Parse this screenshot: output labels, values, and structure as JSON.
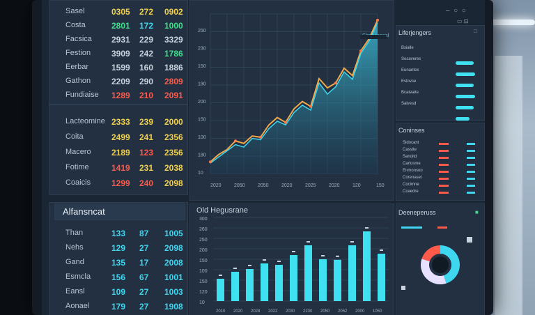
{
  "colors": {
    "yellow": "#f3d04a",
    "green": "#3ee08a",
    "cyan": "#3fd6f0",
    "red": "#ff5a4a",
    "text": "#c9d3df",
    "accent": "#3fd6f0"
  },
  "left_top_table": {
    "rows": [
      {
        "label": "Sasel",
        "a": "0305",
        "b": "272",
        "c": "0902",
        "colors": [
          "yellow",
          "yellow",
          "yellow"
        ]
      },
      {
        "label": "Costa",
        "a": "2801",
        "b": "172",
        "c": "1000",
        "colors": [
          "green",
          "cyan",
          "green"
        ]
      },
      {
        "label": "Facsica",
        "a": "2931",
        "b": "229",
        "c": "3329",
        "colors": [
          "text",
          "text",
          "text"
        ]
      },
      {
        "label": "Festion",
        "a": "3909",
        "b": "242",
        "c": "1786",
        "colors": [
          "text",
          "text",
          "green"
        ]
      },
      {
        "label": "Eerbar",
        "a": "1599",
        "b": "160",
        "c": "1886",
        "colors": [
          "text",
          "text",
          "text"
        ]
      },
      {
        "label": "Gathon",
        "a": "2209",
        "b": "290",
        "c": "2809",
        "colors": [
          "text",
          "text",
          "red"
        ]
      },
      {
        "label": "Fundiaise",
        "a": "1289",
        "b": "210",
        "c": "2091",
        "colors": [
          "red",
          "red",
          "red"
        ]
      }
    ]
  },
  "left_mid_table": {
    "rows": [
      {
        "label": "Lacteomine",
        "a": "2333",
        "b": "239",
        "c": "2000",
        "colors": [
          "yellow",
          "yellow",
          "yellow"
        ]
      },
      {
        "label": "Coita",
        "a": "2499",
        "b": "241",
        "c": "2356",
        "colors": [
          "yellow",
          "yellow",
          "yellow"
        ]
      },
      {
        "label": "Macero",
        "a": "2189",
        "b": "123",
        "c": "2356",
        "colors": [
          "yellow",
          "red",
          "yellow"
        ]
      },
      {
        "label": "Fotime",
        "a": "1419",
        "b": "231",
        "c": "2038",
        "colors": [
          "red",
          "yellow",
          "yellow"
        ]
      },
      {
        "label": "Coaicis",
        "a": "1299",
        "b": "240",
        "c": "2098",
        "colors": [
          "red",
          "red",
          "yellow"
        ]
      }
    ]
  },
  "left_bottom": {
    "title": "Alfansncat",
    "rows": [
      {
        "label": "Than",
        "a": "133",
        "b": "87",
        "c": "1005"
      },
      {
        "label": "Nehs",
        "a": "129",
        "b": "27",
        "c": "2098"
      },
      {
        "label": "Gand",
        "a": "135",
        "b": "17",
        "c": "2008"
      },
      {
        "label": "Esmcla",
        "a": "156",
        "b": "67",
        "c": "1001"
      },
      {
        "label": "Eansl",
        "a": "109",
        "b": "27",
        "c": "1003"
      },
      {
        "label": "Aonael",
        "a": "179",
        "b": "27",
        "c": "1908"
      }
    ]
  },
  "line_chart": {
    "header_text": "Slsdeconeal",
    "y_ticks": [
      "250",
      "230",
      "150",
      "180",
      "200",
      "150",
      "100",
      "180",
      "10"
    ],
    "x_ticks": [
      "2020",
      "2050",
      "2050",
      "2020",
      "2025",
      "2020",
      "120",
      "150"
    ]
  },
  "bar_chart": {
    "title": "Old Hegusrane",
    "y_ticks": [
      "300",
      "260",
      "250",
      "200",
      "150",
      "100",
      "150",
      "120",
      "10"
    ],
    "x_ticks": [
      "2010",
      "2020",
      "2028",
      "2022",
      "2030",
      "2230",
      "2050",
      "2052",
      "2000",
      "1050"
    ]
  },
  "chart_data": [
    {
      "type": "area",
      "title": "",
      "x": [
        1,
        2,
        3,
        4,
        5,
        6,
        7,
        8,
        9,
        10,
        11,
        12,
        13,
        14,
        15,
        16,
        17,
        18,
        19,
        20,
        21
      ],
      "series": [
        {
          "values": [
            20,
            32,
            40,
            54,
            50,
            62,
            60,
            80,
            92,
            84,
            106,
            118,
            110,
            155,
            140,
            148,
            172,
            160,
            200,
            220,
            250
          ]
        },
        {
          "values": [
            18,
            28,
            38,
            48,
            44,
            58,
            56,
            74,
            86,
            80,
            100,
            112,
            104,
            148,
            130,
            142,
            166,
            154,
            196,
            216,
            246
          ]
        }
      ],
      "ylim": [
        0,
        260
      ]
    },
    {
      "type": "bar",
      "title": "Old Hegusrane",
      "categories": [
        "1",
        "2",
        "3",
        "4",
        "5",
        "6",
        "7",
        "8",
        "9",
        "10",
        "11",
        "12"
      ],
      "values": [
        80,
        105,
        115,
        135,
        130,
        165,
        200,
        150,
        148,
        200,
        250,
        170
      ],
      "ylim": [
        0,
        300
      ]
    },
    {
      "type": "pie",
      "title": "Deeneperuss",
      "values": [
        45,
        35,
        20
      ],
      "colors": [
        "#3fd6f0",
        "#e8e0ff",
        "#ff5a4a"
      ]
    }
  ],
  "right_top": {
    "title": "Liferjengers",
    "rows": [
      "Bsialle",
      "Sosaveres",
      "Eunantex",
      "Estovse",
      "Bcateaite",
      "Salvesd"
    ]
  },
  "right_mid": {
    "title": "Coninses",
    "rows": [
      "Sidocant",
      "Cassite",
      "Sanoitd",
      "Carlosme",
      "Enmonsoo",
      "Corenaset",
      "Cocimne",
      "Cceedre"
    ]
  },
  "right_bottom": {
    "title": "Deeneperuss"
  }
}
